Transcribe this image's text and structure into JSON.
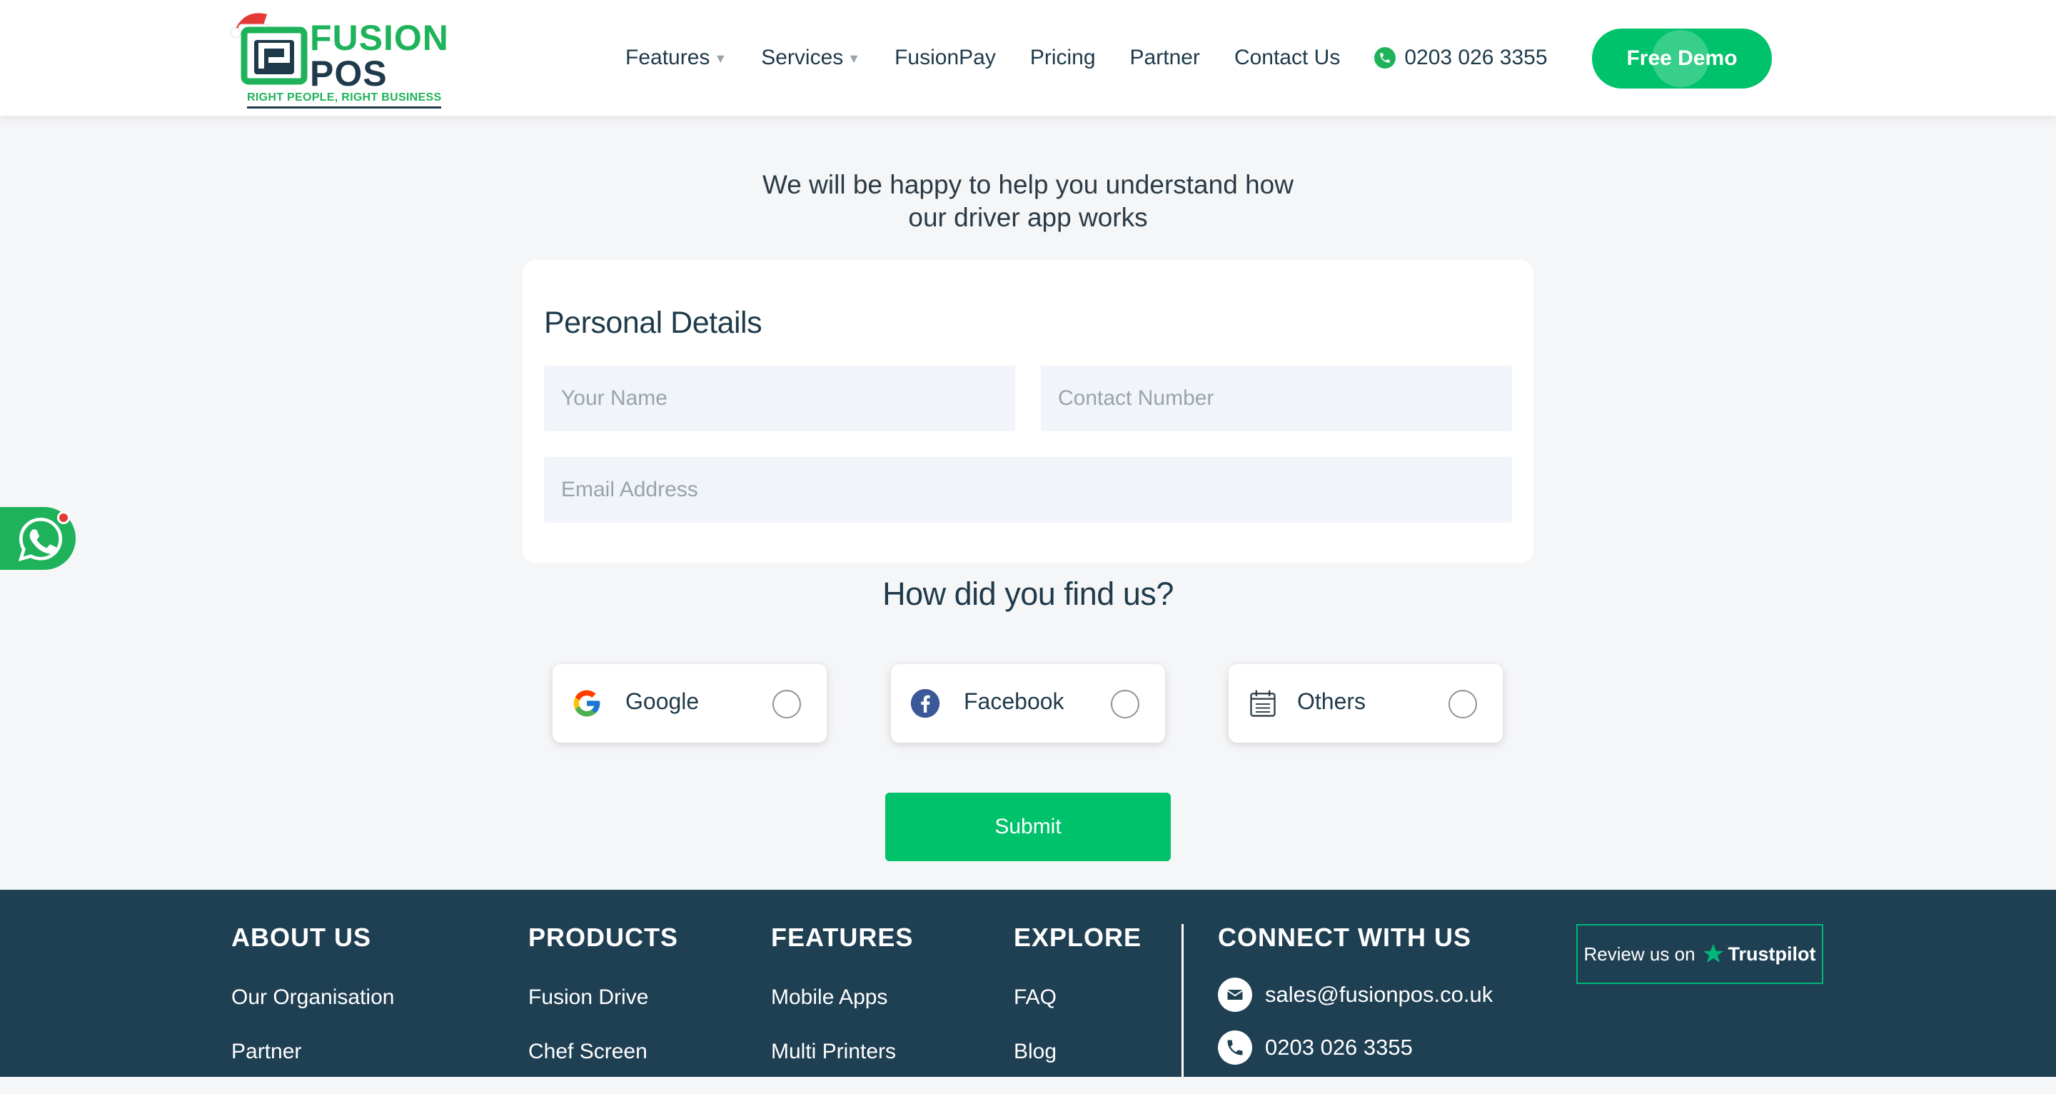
{
  "brand": {
    "name_top": "FUSION",
    "name_bottom": "POS",
    "tagline": "RIGHT PEOPLE, RIGHT BUSINESS"
  },
  "nav": {
    "items": [
      {
        "label": "Features",
        "dropdown": true
      },
      {
        "label": "Services",
        "dropdown": true
      },
      {
        "label": "FusionPay",
        "dropdown": false
      },
      {
        "label": "Pricing",
        "dropdown": false
      },
      {
        "label": "Partner",
        "dropdown": false
      },
      {
        "label": "Contact Us",
        "dropdown": false
      }
    ],
    "phone": "0203 026 3355",
    "demo_label": "Free Demo"
  },
  "intro": {
    "line1": "We will be happy to help you understand how",
    "line2": "our driver app works"
  },
  "form": {
    "title": "Personal Details",
    "name_placeholder": "Your Name",
    "contact_placeholder": "Contact Number",
    "email_placeholder": "Email Address"
  },
  "source": {
    "title": "How did you find us?",
    "options": [
      {
        "label": "Google",
        "icon": "google-icon"
      },
      {
        "label": "Facebook",
        "icon": "facebook-icon"
      },
      {
        "label": "Others",
        "icon": "calendar-icon"
      }
    ],
    "submit_label": "Submit"
  },
  "footer": {
    "about": {
      "heading": "ABOUT US",
      "links": [
        "Our Organisation",
        "Partner"
      ]
    },
    "products": {
      "heading": "PRODUCTS",
      "links": [
        "Fusion Drive",
        "Chef Screen"
      ]
    },
    "features": {
      "heading": "FEATURES",
      "links": [
        "Mobile Apps",
        "Multi Printers"
      ]
    },
    "explore": {
      "heading": "EXPLORE",
      "links": [
        "FAQ",
        "Blog"
      ]
    },
    "connect": {
      "heading": "CONNECT WITH US",
      "email": "sales@fusionpos.co.uk",
      "phone": "0203 026 3355"
    },
    "trustpilot": {
      "review": "Review us on",
      "brand": "Trustpilot"
    }
  },
  "colors": {
    "brand_green": "#00c26b",
    "navy": "#1f3a4a",
    "footer_bg": "#1f3f53",
    "page_bg": "#f5f6f8"
  }
}
